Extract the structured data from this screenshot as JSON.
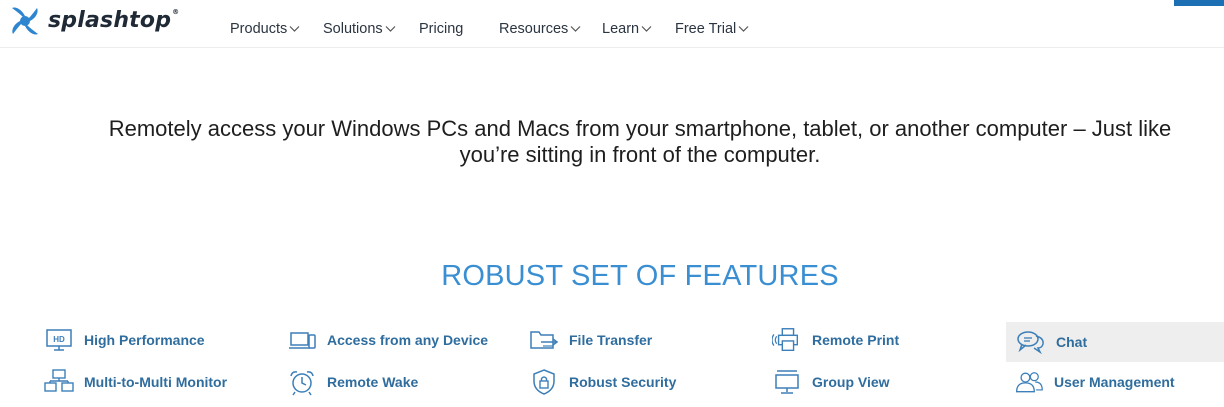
{
  "header": {
    "logo_text": "splashtop",
    "logo_mark": "®",
    "nav": [
      {
        "label": "Products",
        "has_dropdown": true
      },
      {
        "label": "Solutions",
        "has_dropdown": true
      },
      {
        "label": "Pricing",
        "has_dropdown": false
      },
      {
        "label": "Resources",
        "has_dropdown": true
      },
      {
        "label": "Learn",
        "has_dropdown": true
      },
      {
        "label": "Free Trial",
        "has_dropdown": true
      }
    ]
  },
  "hero": {
    "line1": "Remotely access your Windows PCs and Macs from your smartphone, tablet, or another computer – Just like",
    "line2": "you’re sitting in front of the computer."
  },
  "features": {
    "title": "ROBUST SET OF FEATURES",
    "items": [
      {
        "label": "High Performance",
        "icon": "hd-monitor-icon"
      },
      {
        "label": "Access from any Device",
        "icon": "devices-icon"
      },
      {
        "label": "File Transfer",
        "icon": "folder-transfer-icon"
      },
      {
        "label": "Remote Print",
        "icon": "printer-icon"
      },
      {
        "label": "Chat",
        "icon": "chat-bubbles-icon",
        "selected": true
      },
      {
        "label": "Multi-to-Multi Monitor",
        "icon": "multi-monitor-icon"
      },
      {
        "label": "Remote Wake",
        "icon": "alarm-clock-icon"
      },
      {
        "label": "Robust Security",
        "icon": "shield-lock-icon"
      },
      {
        "label": "Group View",
        "icon": "group-view-icon"
      },
      {
        "label": "User Management",
        "icon": "users-icon"
      }
    ]
  },
  "colors": {
    "accent": "#3a8fd3",
    "feature_label": "#2f6d9e",
    "icon": "#3d7fb8",
    "selected_bg": "#eeeeee"
  }
}
